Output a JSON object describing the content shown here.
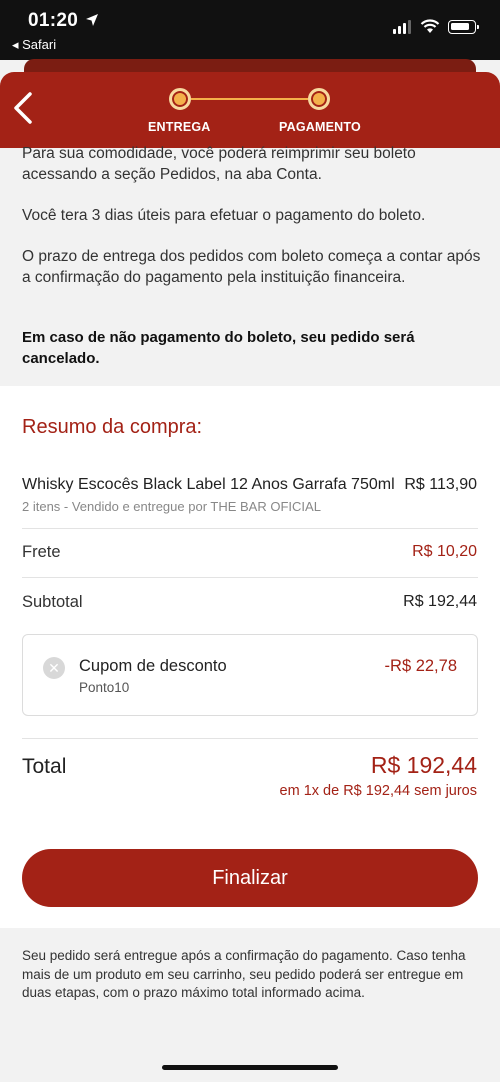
{
  "status_bar": {
    "time": "01:20",
    "back_app": "◂ Safari"
  },
  "header": {
    "steps": [
      {
        "label": "ENTREGA"
      },
      {
        "label": "PAGAMENTO"
      }
    ]
  },
  "info": {
    "p1": "Para sua comodidade, você poderá reimprimir seu boleto acessando a seção Pedidos, na aba Conta.",
    "p2": "Você tera 3 dias úteis para efetuar o pagamento do boleto.",
    "p3": "O prazo de entrega dos pedidos com boleto começa a contar após a confirmação do pagamento pela instituição financeira.",
    "p4": "Em caso de não pagamento do boleto, seu pedido será cancelado."
  },
  "summary": {
    "title": "Resumo da compra:",
    "item": {
      "name": "Whisky Escocês Black Label 12 Anos Garrafa 750ml",
      "price": "R$ 113,90",
      "sub": "2 itens - Vendido e entregue por THE BAR OFICIAL"
    },
    "shipping_label": "Frete",
    "shipping_value": "R$ 10,20",
    "subtotal_label": "Subtotal",
    "subtotal_value": "R$ 192,44",
    "coupon": {
      "title": "Cupom de desconto",
      "code": "Ponto10",
      "value": "-R$ 22,78",
      "remove_glyph": "✕"
    },
    "total_label": "Total",
    "total_value": "R$ 192,44",
    "installments": "em 1x de R$ 192,44 sem juros",
    "finalize_label": "Finalizar"
  },
  "footer_note": "Seu pedido será entregue após a confirmação do pagamento. Caso tenha mais de um produto em seu carrinho, seu pedido poderá ser entregue em duas etapas, com o prazo máximo total informado acima.",
  "colors": {
    "brand": "#a32216",
    "step": "#f4b04a"
  }
}
